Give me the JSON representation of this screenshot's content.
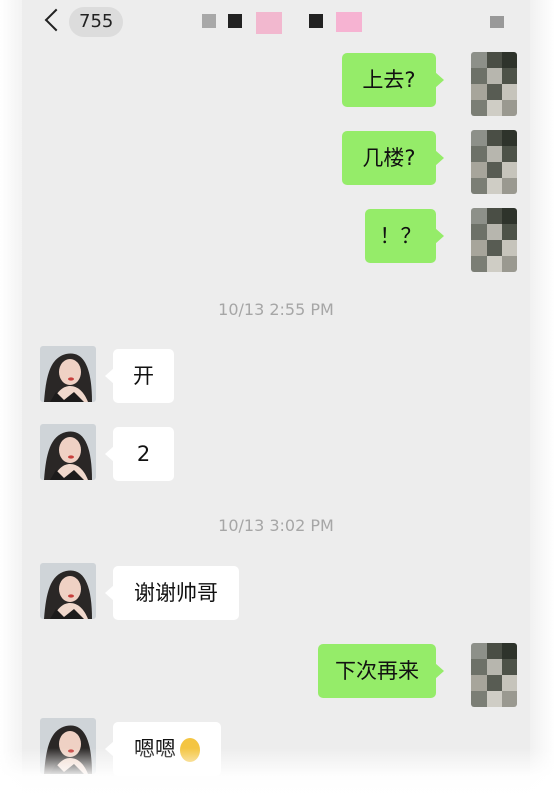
{
  "header": {
    "back_count": "755"
  },
  "colors": {
    "background": "#ededed",
    "outgoing_bubble": "#95ec69",
    "incoming_bubble": "#ffffff",
    "timestamp_text": "#a6a6a6"
  },
  "icons": [
    "back-chevron-icon",
    "more-icon",
    "smile-emoji-icon"
  ],
  "messages": [
    {
      "from": "me",
      "text": "上去?"
    },
    {
      "from": "me",
      "text": "几楼?"
    },
    {
      "from": "me",
      "text": "！？"
    },
    {
      "type": "timestamp",
      "text": "10/13 2:55 PM"
    },
    {
      "from": "contact",
      "text": "开"
    },
    {
      "from": "contact",
      "text": "2"
    },
    {
      "type": "timestamp",
      "text": "10/13 3:02 PM"
    },
    {
      "from": "contact",
      "text": "谢谢帅哥"
    },
    {
      "from": "me",
      "text": "下次再来"
    },
    {
      "from": "contact",
      "text": "嗯嗯"
    }
  ]
}
